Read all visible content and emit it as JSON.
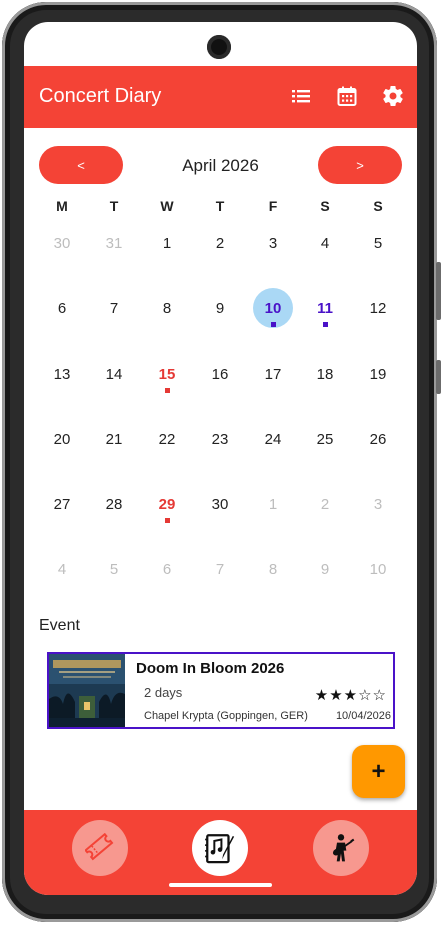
{
  "app": {
    "title": "Concert Diary"
  },
  "calendar": {
    "prev_label": "<",
    "next_label": ">",
    "month_label": "April 2026",
    "weekdays": [
      "M",
      "T",
      "W",
      "T",
      "F",
      "S",
      "S"
    ],
    "weeks": [
      [
        {
          "d": "30",
          "dim": true
        },
        {
          "d": "31",
          "dim": true
        },
        {
          "d": "1"
        },
        {
          "d": "2"
        },
        {
          "d": "3"
        },
        {
          "d": "4"
        },
        {
          "d": "5"
        }
      ],
      [
        {
          "d": "6"
        },
        {
          "d": "7"
        },
        {
          "d": "8"
        },
        {
          "d": "9"
        },
        {
          "d": "10",
          "today": true,
          "event": "blue"
        },
        {
          "d": "11",
          "event": "blue"
        },
        {
          "d": "12"
        }
      ],
      [
        {
          "d": "13"
        },
        {
          "d": "14"
        },
        {
          "d": "15",
          "event": "red"
        },
        {
          "d": "16"
        },
        {
          "d": "17"
        },
        {
          "d": "18"
        },
        {
          "d": "19"
        }
      ],
      [
        {
          "d": "20"
        },
        {
          "d": "21"
        },
        {
          "d": "22"
        },
        {
          "d": "23"
        },
        {
          "d": "24"
        },
        {
          "d": "25"
        },
        {
          "d": "26"
        }
      ],
      [
        {
          "d": "27"
        },
        {
          "d": "28"
        },
        {
          "d": "29",
          "event": "red"
        },
        {
          "d": "30"
        },
        {
          "d": "1",
          "dim": true
        },
        {
          "d": "2",
          "dim": true
        },
        {
          "d": "3",
          "dim": true
        }
      ],
      [
        {
          "d": "4",
          "dim": true
        },
        {
          "d": "5",
          "dim": true
        },
        {
          "d": "6",
          "dim": true
        },
        {
          "d": "7",
          "dim": true
        },
        {
          "d": "8",
          "dim": true
        },
        {
          "d": "9",
          "dim": true
        },
        {
          "d": "10",
          "dim": true
        }
      ]
    ]
  },
  "events_section": {
    "heading": "Event",
    "items": [
      {
        "name": "Doom In Bloom 2026",
        "duration": "2 days",
        "venue": "Chapel Krypta (Goppingen, GER)",
        "date": "10/04/2026",
        "rating": 3,
        "rating_max": 5,
        "stars_text": "★★★☆☆"
      }
    ]
  },
  "fab": {
    "label": "+"
  },
  "colors": {
    "primary": "#f44336",
    "accent": "#ff9800",
    "event_blue": "#4a12c8",
    "event_red": "#e53935",
    "today_bg": "#aad8f5"
  },
  "icons": {
    "appbar": [
      "list-icon",
      "calendar-icon",
      "settings-gear-icon"
    ],
    "bottom_nav": [
      "ticket-icon",
      "music-notebook-icon",
      "guitarist-icon"
    ]
  }
}
